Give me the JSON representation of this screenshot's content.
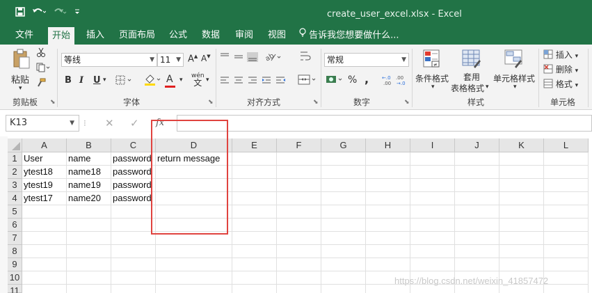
{
  "window": {
    "title": "create_user_excel.xlsx - Excel",
    "quick_access": {
      "save_icon": "save-icon",
      "undo_icon": "undo-icon",
      "redo_icon": "redo-icon",
      "customize_icon": "customize-icon"
    }
  },
  "menu": {
    "items": [
      "文件",
      "开始",
      "插入",
      "页面布局",
      "公式",
      "数据",
      "审阅",
      "视图"
    ],
    "active": "开始",
    "tell_me": "告诉我您想要做什么..."
  },
  "ribbon": {
    "clipboard": {
      "paste_label": "粘贴",
      "group_label": "剪贴板"
    },
    "font": {
      "font_name": "等线",
      "font_size": "11",
      "bold": "B",
      "italic": "I",
      "underline": "U",
      "grow": "A",
      "shrink": "A",
      "color_a": "A",
      "wen": "wén",
      "wen_char": "文",
      "group_label": "字体"
    },
    "alignment": {
      "group_label": "对齐方式"
    },
    "number": {
      "format": "常规",
      "percent": "%",
      "comma": ",",
      "group_label": "数字"
    },
    "styles": {
      "conditional": "条件格式",
      "table_format_1": "套用",
      "table_format_2": "表格格式",
      "cell_styles": "单元格样式",
      "group_label": "样式"
    },
    "cells": {
      "insert": "插入",
      "delete": "删除",
      "format": "格式",
      "group_label": "单元格"
    }
  },
  "formula_bar": {
    "name_box": "K13",
    "fx": "fx",
    "content": ""
  },
  "sheet": {
    "columns": [
      "A",
      "B",
      "C",
      "D",
      "E",
      "F",
      "G",
      "H",
      "I",
      "J",
      "K",
      "L"
    ],
    "rows": [
      "1",
      "2",
      "3",
      "4",
      "5",
      "6",
      "7",
      "8",
      "9",
      "10",
      "11"
    ],
    "data": [
      [
        "User",
        "name",
        "password",
        "return message"
      ],
      [
        "ytest18",
        "name18",
        "password",
        ""
      ],
      [
        "ytest19",
        "name19",
        "password",
        ""
      ],
      [
        "ytest17",
        "name20",
        "password",
        ""
      ]
    ]
  },
  "annotation": {
    "color": "#e0433f"
  },
  "watermark": "https://blog.csdn.net/weixin_41857472",
  "colors": {
    "excel_green": "#217346",
    "ribbon_bg": "#f3f3f3"
  }
}
